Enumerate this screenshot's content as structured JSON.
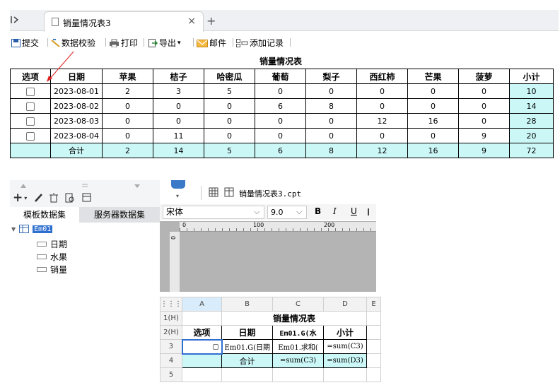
{
  "tabbar": {
    "tab_title": "销量情况表3",
    "toggle_icon": "sidebar-toggle-icon",
    "new_tab": "+",
    "close": "×"
  },
  "toolbar": {
    "submit": "提交",
    "validate": "数据校验",
    "print": "打印",
    "export": "导出",
    "export_arrow": "▾",
    "mail": "邮件",
    "add_record": "添加记录"
  },
  "report": {
    "title": "销量情况表",
    "headers": [
      "选项",
      "日期",
      "苹果",
      "桔子",
      "哈密瓜",
      "葡萄",
      "梨子",
      "西红柿",
      "芒果",
      "菠萝",
      "小计"
    ],
    "rows": [
      [
        "2023-08-01",
        "2",
        "3",
        "5",
        "0",
        "0",
        "0",
        "0",
        "0",
        "10"
      ],
      [
        "2023-08-02",
        "0",
        "0",
        "0",
        "6",
        "8",
        "0",
        "0",
        "0",
        "14"
      ],
      [
        "2023-08-03",
        "0",
        "0",
        "0",
        "0",
        "0",
        "12",
        "16",
        "0",
        "28"
      ],
      [
        "2023-08-04",
        "0",
        "11",
        "0",
        "0",
        "0",
        "0",
        "0",
        "9",
        "20"
      ]
    ],
    "total": [
      "合计",
      "2",
      "14",
      "5",
      "6",
      "8",
      "12",
      "16",
      "9",
      "72"
    ]
  },
  "left_panel": {
    "tab_template": "模板数据集",
    "tab_server": "服务器数据集",
    "dataset": "Em01",
    "fields": [
      "日期",
      "水果",
      "销量"
    ],
    "add_label": "+"
  },
  "designer": {
    "file_name": "销量情况表3.cpt",
    "font_name": "宋体",
    "font_size": "9.0",
    "bold": "B",
    "italic": "I",
    "underline": "U",
    "ruler": [
      "0",
      "100",
      "200"
    ],
    "vruler": "0",
    "col_headers": [
      "A",
      "B",
      "C",
      "D",
      "E"
    ],
    "row_headers": [
      "1(H)",
      "2(H)",
      "3",
      "4",
      "5"
    ],
    "title": "销量情况表",
    "r2": [
      "选项",
      "日期",
      "Em01.G(水",
      "小计"
    ],
    "r3": [
      "",
      "Em01.G(日期",
      "Em01.求和(",
      "=sum(C3)"
    ],
    "r4": [
      "",
      "合计",
      "=sum(C3)",
      "=sum(D3)"
    ]
  }
}
